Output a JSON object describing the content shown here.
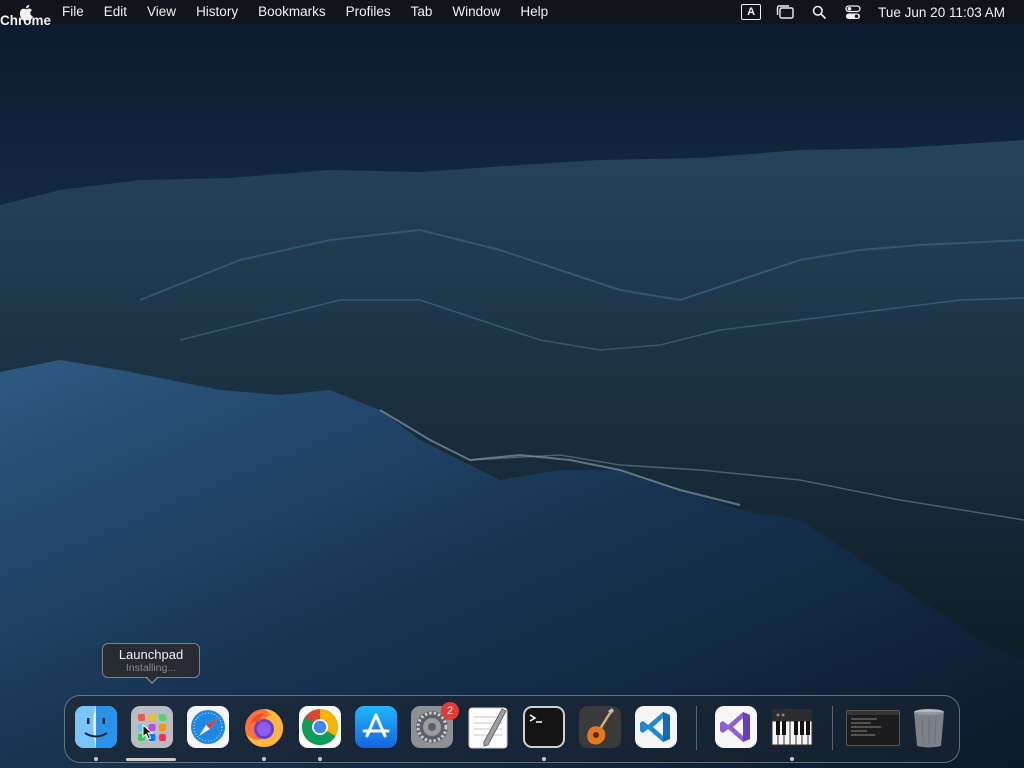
{
  "menubar": {
    "app_name": "Chrome",
    "items": [
      "File",
      "Edit",
      "View",
      "History",
      "Bookmarks",
      "Profiles",
      "Tab",
      "Window",
      "Help"
    ],
    "input_source": "A",
    "clock": "Tue Jun 20  11:03 AM",
    "status_icons": [
      "input-source-icon",
      "stage-manager-icon",
      "spotlight-search-icon",
      "control-center-icon"
    ]
  },
  "tooltip": {
    "title": "Launchpad",
    "subtitle": "Installing..."
  },
  "dock": {
    "apps": [
      "Finder",
      "Launchpad",
      "Safari",
      "Firefox",
      "Chrome",
      "App Store",
      "System Preferences",
      "TextEdit",
      "Terminal",
      "GarageBand",
      "Visual Studio Code",
      "Visual Studio",
      "Piano"
    ],
    "settings_badge": "2"
  }
}
